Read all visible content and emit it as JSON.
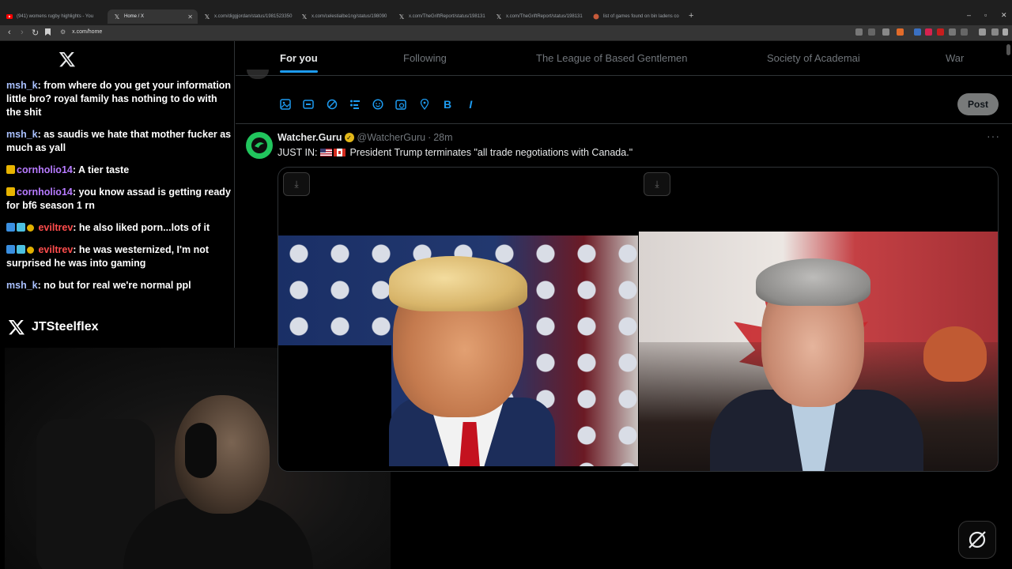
{
  "browser": {
    "tabs": [
      {
        "title": "(941) womens rugby highlights - You",
        "icon": "youtube-icon",
        "active": false
      },
      {
        "title": "Home / X",
        "icon": "x-icon",
        "active": true
      },
      {
        "title": "x.com/diggjordan/status/1981523350",
        "icon": "x-icon",
        "active": false
      },
      {
        "title": "x.com/celestialbe1ng/status/198090",
        "icon": "x-icon",
        "active": false
      },
      {
        "title": "x.com/TheGriftReport/status/198131",
        "icon": "x-icon",
        "active": false
      },
      {
        "title": "x.com/TheGriftReport/status/198131",
        "icon": "x-icon",
        "active": false
      },
      {
        "title": "list of games found on bin ladens co",
        "icon": "globe-icon",
        "active": false
      }
    ],
    "url": "x.com/home",
    "new_tab_glyph": "+",
    "window_controls": {
      "minimize": "–",
      "restore": "▫",
      "close": "✕"
    },
    "nav_glyphs": {
      "back": "‹",
      "forward": "›",
      "reload": "↻"
    }
  },
  "stream": {
    "chat": [
      {
        "user": "msh_k",
        "color": "blue",
        "badges": [],
        "text": ": from where do you get your information little bro? royal family has nothing to do with the shit"
      },
      {
        "user": "msh_k",
        "color": "blue",
        "badges": [],
        "text": ": as saudis we hate that mother fucker as much as yall"
      },
      {
        "user": "cornholio14",
        "color": "purple",
        "badges": [
          "crown"
        ],
        "text": ": A tier taste"
      },
      {
        "user": "cornholio14",
        "color": "purple",
        "badges": [
          "crown"
        ],
        "text": ": you know assad is getting ready for bf6 season 1 rn"
      },
      {
        "user": "eviltrev",
        "color": "red",
        "badges": [
          "blue",
          "grid",
          "one"
        ],
        "text": ": he also liked porn...lots of it"
      },
      {
        "user": "eviltrev",
        "color": "red",
        "badges": [
          "blue",
          "grid",
          "one"
        ],
        "text": ": he was westernized, I'm not surprised he was into gaming"
      },
      {
        "user": "msh_k",
        "color": "blue",
        "badges": [],
        "text": ": no but for real we're normal ppl"
      }
    ],
    "handle": "JTSteelflex"
  },
  "x": {
    "tabs": [
      {
        "label": "For you",
        "active": true
      },
      {
        "label": "Following",
        "active": false
      },
      {
        "label": "The League of Based Gentlemen",
        "active": false
      },
      {
        "label": "Society of Academai",
        "active": false
      },
      {
        "label": "War",
        "active": false
      }
    ],
    "composer": {
      "tools": [
        "image-icon",
        "gif-icon",
        "grok-icon",
        "poll-icon",
        "emoji-icon",
        "schedule-icon",
        "location-icon",
        "bold-icon",
        "italic-icon"
      ],
      "bold_glyph": "B",
      "italic_glyph": "I",
      "post_label": "Post"
    },
    "tweet": {
      "name": "Watcher.Guru",
      "handle": "@WatcherGuru",
      "separator": "·",
      "time": "28m",
      "more_glyph": "···",
      "text_prefix": "JUST IN:",
      "flags": [
        "us-flag",
        "canada-flag"
      ],
      "text": "President Trump terminates \"all trade negotiations with Canada.\"",
      "media": [
        {
          "subject": "trump-photo",
          "download_icon": "download-icon"
        },
        {
          "subject": "carney-photo",
          "download_icon": "download-icon"
        }
      ]
    }
  },
  "colors": {
    "accent": "#1d9bf0",
    "verified": "#e2b719",
    "watcher_green": "#21c55d",
    "chat_blue": "#a9c1ff",
    "chat_purple": "#b77bff",
    "chat_red": "#ff4d4d"
  }
}
